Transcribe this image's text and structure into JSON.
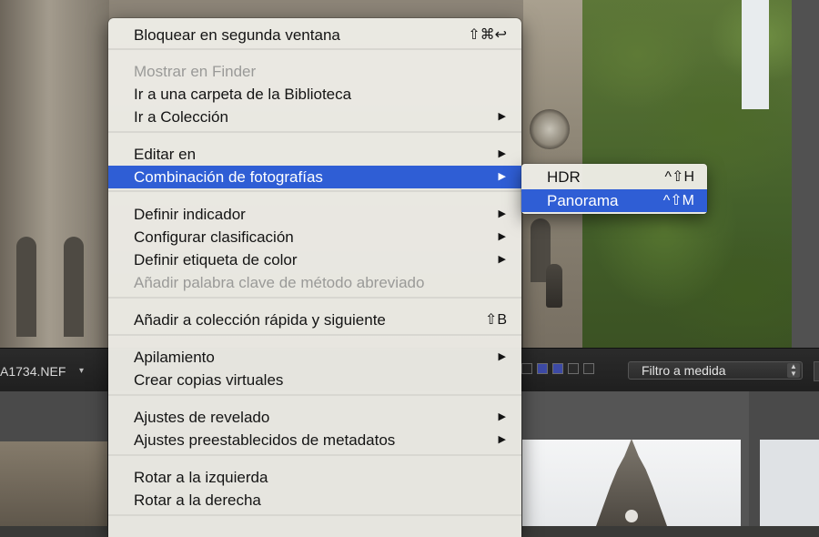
{
  "context_menu": {
    "items": [
      {
        "label": "Bloquear en segunda ventana",
        "shortcut": "⇧⌘↩",
        "submenu": false,
        "disabled": false
      },
      {
        "label": "Mostrar en Finder",
        "shortcut": "",
        "submenu": false,
        "disabled": true
      },
      {
        "label": "Ir a una carpeta de la Biblioteca",
        "shortcut": "",
        "submenu": false,
        "disabled": false
      },
      {
        "label": "Ir a Colección",
        "shortcut": "",
        "submenu": true,
        "disabled": false
      },
      {
        "label": "Editar en",
        "shortcut": "",
        "submenu": true,
        "disabled": false
      },
      {
        "label": "Combinación de fotografías",
        "shortcut": "",
        "submenu": true,
        "disabled": false,
        "highlighted": true
      },
      {
        "label": "Definir indicador",
        "shortcut": "",
        "submenu": true,
        "disabled": false
      },
      {
        "label": "Configurar clasificación",
        "shortcut": "",
        "submenu": true,
        "disabled": false
      },
      {
        "label": "Definir etiqueta de color",
        "shortcut": "",
        "submenu": true,
        "disabled": false
      },
      {
        "label": "Añadir palabra clave de método abreviado",
        "shortcut": "",
        "submenu": false,
        "disabled": true
      },
      {
        "label": "Añadir a colección rápida y siguiente",
        "shortcut": "⇧B",
        "submenu": false,
        "disabled": false
      },
      {
        "label": "Apilamiento",
        "shortcut": "",
        "submenu": true,
        "disabled": false
      },
      {
        "label": "Crear copias virtuales",
        "shortcut": "",
        "submenu": false,
        "disabled": false
      },
      {
        "label": "Ajustes de revelado",
        "shortcut": "",
        "submenu": true,
        "disabled": false
      },
      {
        "label": "Ajustes preestablecidos de metadatos",
        "shortcut": "",
        "submenu": true,
        "disabled": false
      },
      {
        "label": "Rotar a la izquierda",
        "shortcut": "",
        "submenu": false,
        "disabled": false
      },
      {
        "label": "Rotar a la derecha",
        "shortcut": "",
        "submenu": false,
        "disabled": false
      }
    ],
    "submenu_arrow": "▶"
  },
  "photo_merge_submenu": {
    "items": [
      {
        "label": "HDR",
        "shortcut": "^⇧H",
        "highlighted": false
      },
      {
        "label": "Panorama",
        "shortcut": "^⇧M",
        "highlighted": true
      }
    ]
  },
  "toolbar": {
    "filename": "A1734.NEF",
    "filename_arrow": "▾",
    "filter_label": "Filtro a medida",
    "filter_arrows": "▲▼",
    "color_swatches": [
      "none",
      "blue",
      "blue",
      "none",
      "none"
    ]
  },
  "colors": {
    "highlight": "#2f5ed5",
    "menu_background": "#eeede7",
    "toolbar_background": "#222222"
  }
}
